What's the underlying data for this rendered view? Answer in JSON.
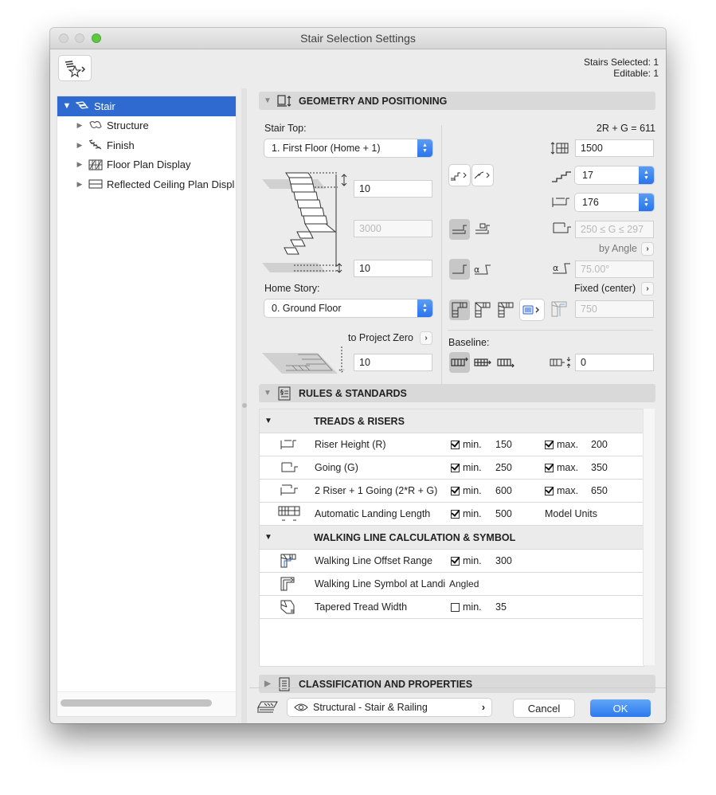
{
  "window": {
    "title": "Stair Selection Settings"
  },
  "header": {
    "stairs_selected": "Stairs Selected: 1",
    "editable": "Editable: 1"
  },
  "tree": {
    "items": [
      {
        "label": "Stair",
        "icon": "stair-icon",
        "selected": true,
        "expanded": true
      },
      {
        "label": "Structure",
        "icon": "structure-icon"
      },
      {
        "label": "Finish",
        "icon": "finish-icon"
      },
      {
        "label": "Floor Plan Display",
        "icon": "floor-plan-icon"
      },
      {
        "label": "Reflected Ceiling Plan Displ",
        "icon": "ceiling-plan-icon"
      }
    ]
  },
  "geometry": {
    "title": "GEOMETRY AND POSITIONING",
    "stair_top_label": "Stair Top:",
    "stair_top_value": "1. First Floor (Home + 1)",
    "top_offset": "10",
    "total_height": "3000",
    "bottom_offset": "10",
    "home_story_label": "Home Story:",
    "home_story_value": "0. Ground Floor",
    "to_project_zero": "to Project Zero",
    "project_zero_value": "10",
    "formula": "2R + G = 611",
    "flight_width": "1500",
    "riser_count": "17",
    "riser_height": "176",
    "going_range": "250 ≤ G ≤ 297",
    "by_angle": "by Angle",
    "angle": "75.00°",
    "fixed_center": "Fixed (center)",
    "landing_value": "750",
    "baseline_label": "Baseline:",
    "baseline_offset": "0"
  },
  "rules": {
    "title": "RULES & STANDARDS",
    "groups": [
      {
        "title": "TREADS & RISERS",
        "rows": [
          {
            "name": "Riser Height (R)",
            "min_checked": true,
            "min_label": "min.",
            "min": "150",
            "max_checked": true,
            "max_label": "max.",
            "max": "200"
          },
          {
            "name": "Going (G)",
            "min_checked": true,
            "min_label": "min.",
            "min": "250",
            "max_checked": true,
            "max_label": "max.",
            "max": "350"
          },
          {
            "name": "2 Riser + 1 Going (2*R + G)",
            "min_checked": true,
            "min_label": "min.",
            "min": "600",
            "max_checked": true,
            "max_label": "max.",
            "max": "650"
          },
          {
            "name": "Automatic Landing Length",
            "min_checked": true,
            "min_label": "min.",
            "min": "500",
            "extra": "Model Units"
          }
        ]
      },
      {
        "title": "WALKING LINE CALCULATION & SYMBOL",
        "rows": [
          {
            "name": "Walking Line Offset Range",
            "min_checked": true,
            "min_label": "min.",
            "min": "300"
          },
          {
            "name": "Walking Line Symbol at Landi",
            "value": "Angled"
          },
          {
            "name": "Tapered Tread Width",
            "min_checked": false,
            "min_label": "min.",
            "min": "35"
          }
        ]
      }
    ]
  },
  "classification": {
    "title": "CLASSIFICATION AND PROPERTIES"
  },
  "footer": {
    "favorite": "Structural - Stair & Railing",
    "cancel": "Cancel",
    "ok": "OK"
  },
  "colors": {
    "accent": "#2f6ad0",
    "ok_button": "#3a85f0",
    "traffic_green": "#5ec93f"
  }
}
